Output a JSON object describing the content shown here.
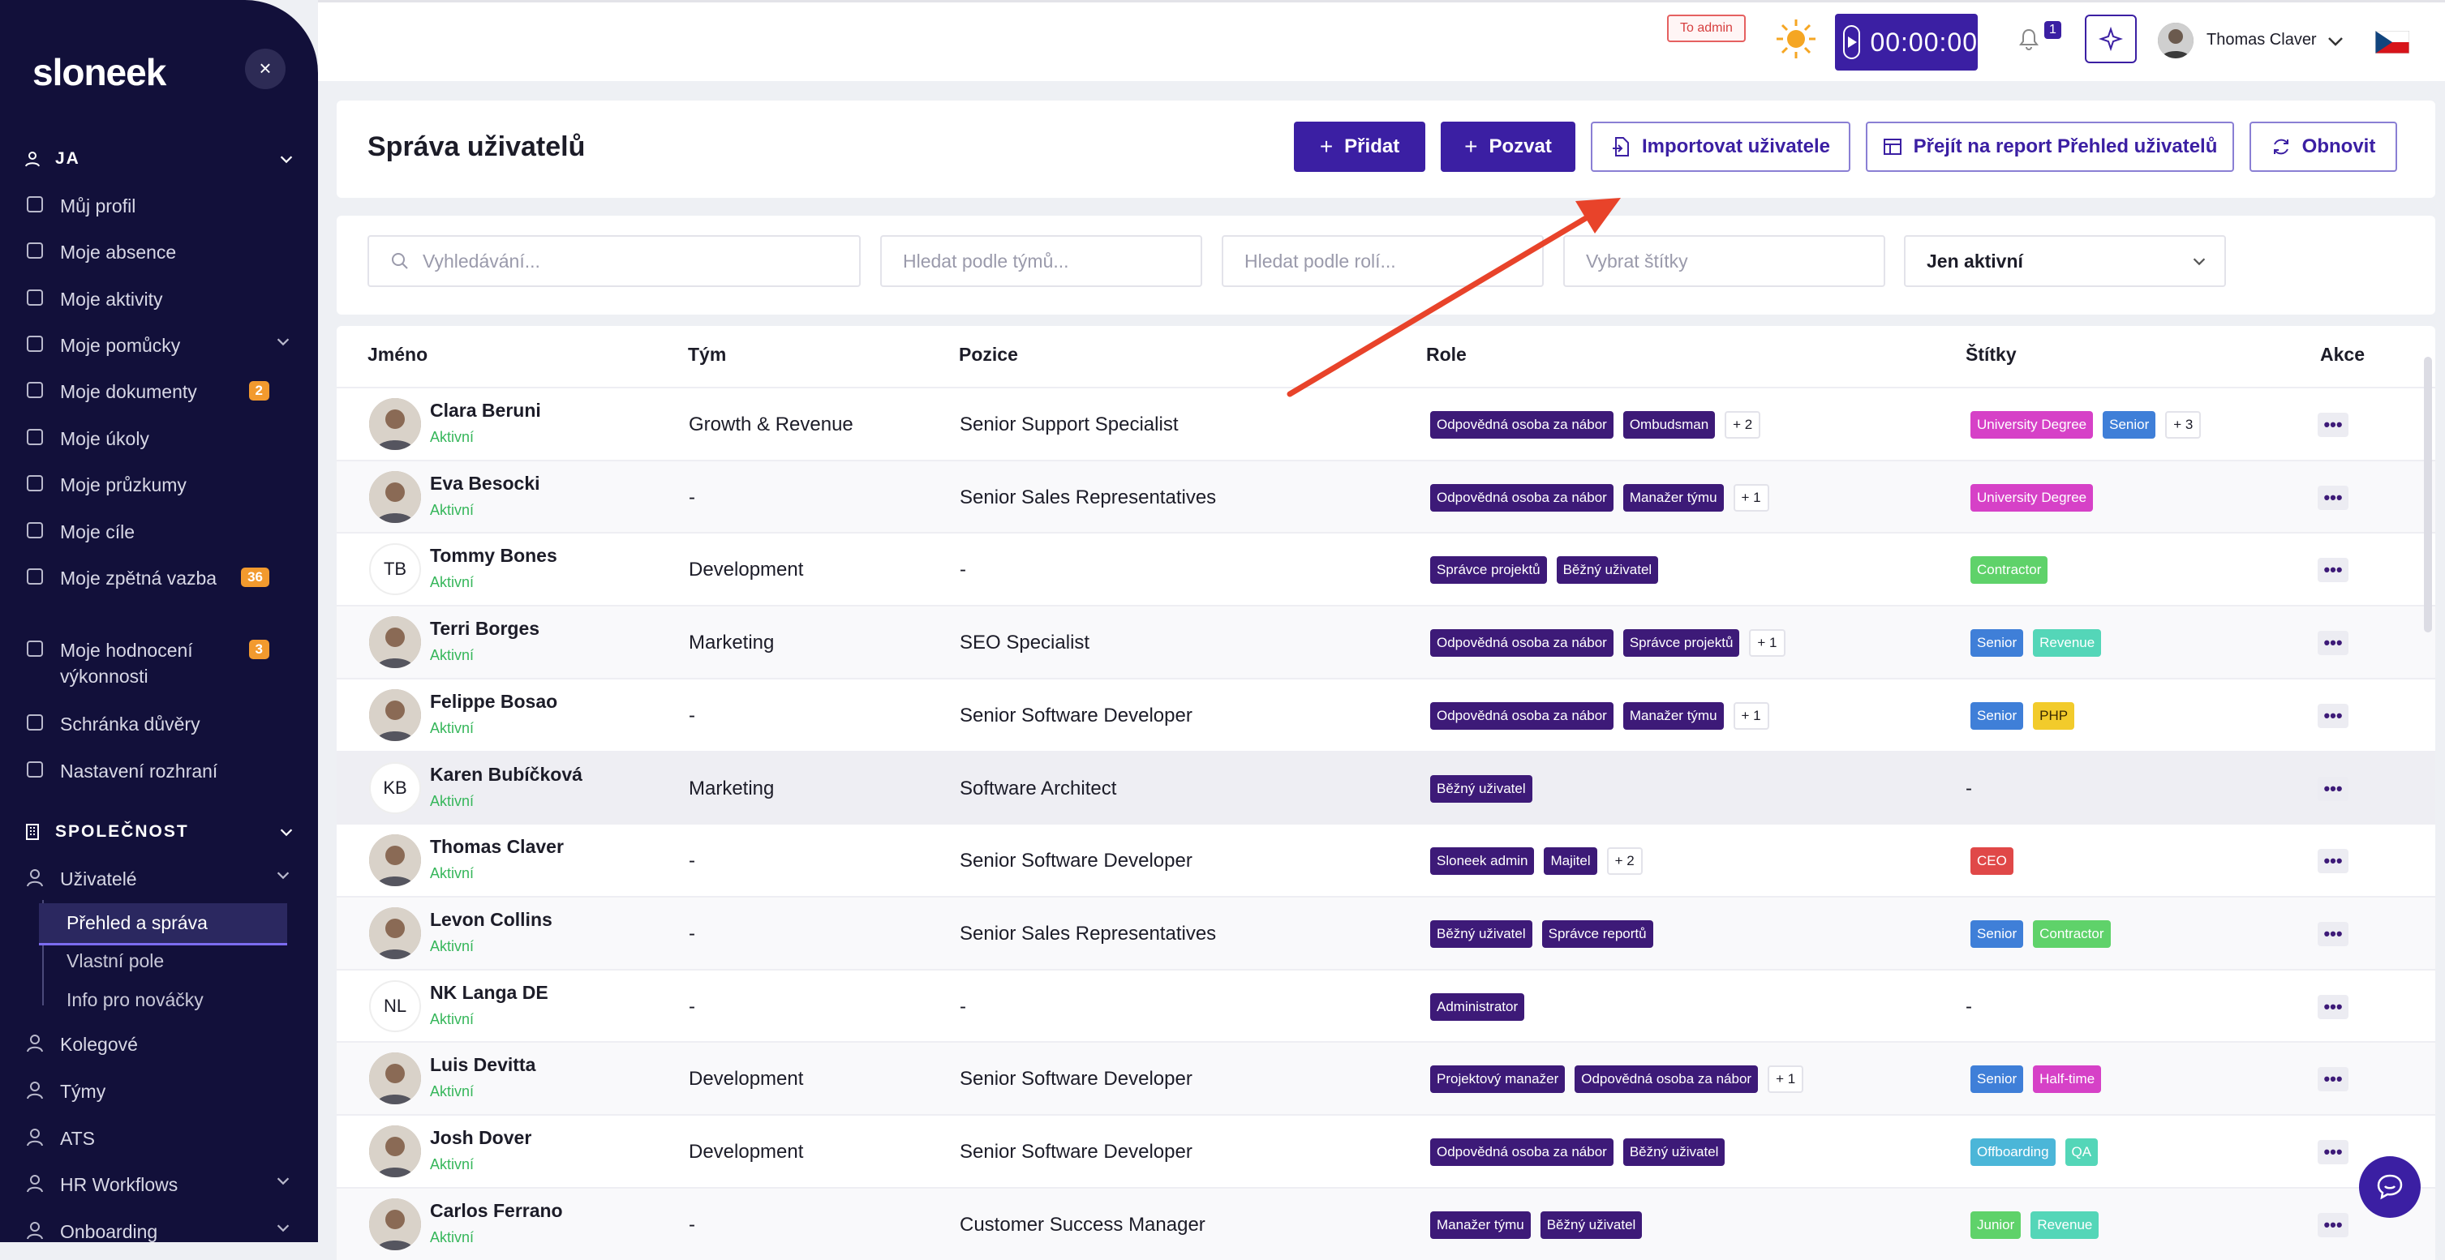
{
  "sidebar": {
    "logo": "sloneek",
    "close_icon": "×",
    "section_ja": "JA",
    "section_company": "SPOLEČNOST",
    "items_ja": [
      {
        "label": "Můj profil",
        "icon": "user-icon"
      },
      {
        "label": "Moje absence",
        "icon": "calendar-icon"
      },
      {
        "label": "Moje aktivity",
        "icon": "book-icon"
      },
      {
        "label": "Moje pomůcky",
        "icon": "tools-icon"
      },
      {
        "label": "Moje dokumenty",
        "icon": "folder-icon",
        "badge": "2"
      },
      {
        "label": "Moje úkoly",
        "icon": "tasks-icon"
      },
      {
        "label": "Moje průzkumy",
        "icon": "survey-icon"
      },
      {
        "label": "Moje cíle",
        "icon": "target-icon"
      },
      {
        "label": "Moje zpětná vazba",
        "icon": "feedback-icon",
        "badge": "36"
      },
      {
        "label": "Moje hodnocení výkonnosti",
        "icon": "rating-icon",
        "badge": "3"
      },
      {
        "label": "Schránka důvěry",
        "icon": "trust-icon"
      },
      {
        "label": "Nastavení rozhraní",
        "icon": "settings-icon"
      }
    ],
    "items_company": [
      {
        "label": "Uživatelé",
        "icon": "users-icon"
      },
      {
        "label": "Kolegové",
        "icon": "colleagues-icon"
      },
      {
        "label": "Týmy",
        "icon": "teams-icon"
      },
      {
        "label": "ATS",
        "icon": "ats-icon"
      },
      {
        "label": "HR Workflows",
        "icon": "workflow-icon"
      },
      {
        "label": "Onboarding",
        "icon": "onboarding-icon"
      }
    ],
    "subitems": [
      "Přehled a správa",
      "Vlastní pole",
      "Info pro nováčky"
    ]
  },
  "topbar": {
    "to_admin": "To admin",
    "timer": "00:00:00",
    "notifications": "1",
    "user_name": "Thomas Claver"
  },
  "header": {
    "title": "Správa uživatelů",
    "add_label": "Přidat",
    "invite_label": "Pozvat",
    "import_label": "Importovat uživatele",
    "report_label": "Přejít na report Přehled uživatelů",
    "refresh_label": "Obnovit"
  },
  "filters": {
    "search_placeholder": "Vyhledávání...",
    "teams_placeholder": "Hledat podle týmů...",
    "roles_placeholder": "Hledat podle rolí...",
    "tags_placeholder": "Vybrat štítky",
    "status_value": "Jen aktivní"
  },
  "table": {
    "columns": [
      "Jméno",
      "Tým",
      "Pozice",
      "Role",
      "Štítky",
      "Akce"
    ],
    "rows": [
      {
        "name": "Clara Beruni",
        "status": "Aktivní",
        "avatar": "photo",
        "team": "Growth & Revenue",
        "position": "Senior Support Specialist",
        "roles": [
          "Odpovědná osoba za nábor",
          "Ombudsman"
        ],
        "roles_more": "+ 2",
        "tags": [
          {
            "t": "University Degree",
            "c": "#d641c7"
          },
          {
            "t": "Senior",
            "c": "#3f7fd8"
          }
        ],
        "tags_more": "+ 3"
      },
      {
        "name": "Eva Besocki",
        "status": "Aktivní",
        "avatar": "photo",
        "team": "-",
        "position": "Senior Sales Representatives",
        "roles": [
          "Odpovědná osoba za nábor",
          "Manažer týmu"
        ],
        "roles_more": "+ 1",
        "tags": [
          {
            "t": "University Degree",
            "c": "#d641c7"
          }
        ],
        "tags_more": ""
      },
      {
        "name": "Tommy Bones",
        "status": "Aktivní",
        "avatar": "TB",
        "team": "Development",
        "position": "-",
        "roles": [
          "Správce projektů",
          "Běžný uživatel"
        ],
        "roles_more": "",
        "tags": [
          {
            "t": "Contractor",
            "c": "#5fd26a"
          }
        ],
        "tags_more": ""
      },
      {
        "name": "Terri Borges",
        "status": "Aktivní",
        "avatar": "photo",
        "team": "Marketing",
        "position": "SEO Specialist",
        "roles": [
          "Odpovědná osoba za nábor",
          "Správce projektů"
        ],
        "roles_more": "+ 1",
        "tags": [
          {
            "t": "Senior",
            "c": "#3f7fd8"
          },
          {
            "t": "Revenue",
            "c": "#54d6b8"
          }
        ],
        "tags_more": ""
      },
      {
        "name": "Felippe Bosao",
        "status": "Aktivní",
        "avatar": "photo",
        "team": "-",
        "position": "Senior Software Developer",
        "roles": [
          "Odpovědná osoba za nábor",
          "Manažer týmu"
        ],
        "roles_more": "+ 1",
        "tags": [
          {
            "t": "Senior",
            "c": "#3f7fd8"
          },
          {
            "t": "PHP",
            "c": "#f2cb2b"
          }
        ],
        "tags_more": ""
      },
      {
        "name": "Karen Bubíčková",
        "status": "Aktivní",
        "avatar": "KB",
        "team": "Marketing",
        "position": "Software Architect",
        "roles": [
          "Běžný uživatel"
        ],
        "roles_more": "",
        "tags": [],
        "tags_more": "",
        "tags_empty": "-"
      },
      {
        "name": "Thomas Claver",
        "status": "Aktivní",
        "avatar": "photo",
        "team": "-",
        "position": "Senior Software Developer",
        "roles": [
          "Sloneek admin",
          "Majitel"
        ],
        "roles_more": "+ 2",
        "tags": [
          {
            "t": "CEO",
            "c": "#e04848"
          }
        ],
        "tags_more": ""
      },
      {
        "name": "Levon Collins",
        "status": "Aktivní",
        "avatar": "photo",
        "team": "-",
        "position": "Senior Sales Representatives",
        "roles": [
          "Běžný uživatel",
          "Správce reportů"
        ],
        "roles_more": "",
        "tags": [
          {
            "t": "Senior",
            "c": "#3f7fd8"
          },
          {
            "t": "Contractor",
            "c": "#5fd26a"
          }
        ],
        "tags_more": ""
      },
      {
        "name": "NK Langa DE",
        "status": "Aktivní",
        "avatar": "NL",
        "team": "-",
        "position": "-",
        "roles": [
          "Administrator"
        ],
        "roles_more": "",
        "tags": [],
        "tags_more": "",
        "tags_empty": "-"
      },
      {
        "name": "Luis Devitta",
        "status": "Aktivní",
        "avatar": "photo",
        "team": "Development",
        "position": "Senior Software Developer",
        "roles": [
          "Projektový manažer",
          "Odpovědná osoba za nábor"
        ],
        "roles_more": "+ 1",
        "tags": [
          {
            "t": "Senior",
            "c": "#3f7fd8"
          },
          {
            "t": "Half-time",
            "c": "#d641c7"
          }
        ],
        "tags_more": ""
      },
      {
        "name": "Josh Dover",
        "status": "Aktivní",
        "avatar": "photo",
        "team": "Development",
        "position": "Senior Software Developer",
        "roles": [
          "Odpovědná osoba za nábor",
          "Běžný uživatel"
        ],
        "roles_more": "",
        "tags": [
          {
            "t": "Offboarding",
            "c": "#4bb6d8"
          },
          {
            "t": "QA",
            "c": "#54d6b8"
          }
        ],
        "tags_more": ""
      },
      {
        "name": "Carlos Ferrano",
        "status": "Aktivní",
        "avatar": "photo",
        "team": "-",
        "position": "Customer Success Manager",
        "roles": [
          "Manažer týmu",
          "Běžný uživatel"
        ],
        "roles_more": "",
        "tags": [
          {
            "t": "Junior",
            "c": "#5fd26a"
          },
          {
            "t": "Revenue",
            "c": "#54d6b8"
          }
        ],
        "tags_more": ""
      }
    ],
    "action_label": "•••"
  },
  "colors": {
    "sidebar_bg": "#12103a",
    "primary": "#3b1fa3",
    "role_chip": "#3d1a78",
    "status_active": "#35b65a",
    "badge": "#f29a2e",
    "annotation_arrow": "#e8432a"
  }
}
